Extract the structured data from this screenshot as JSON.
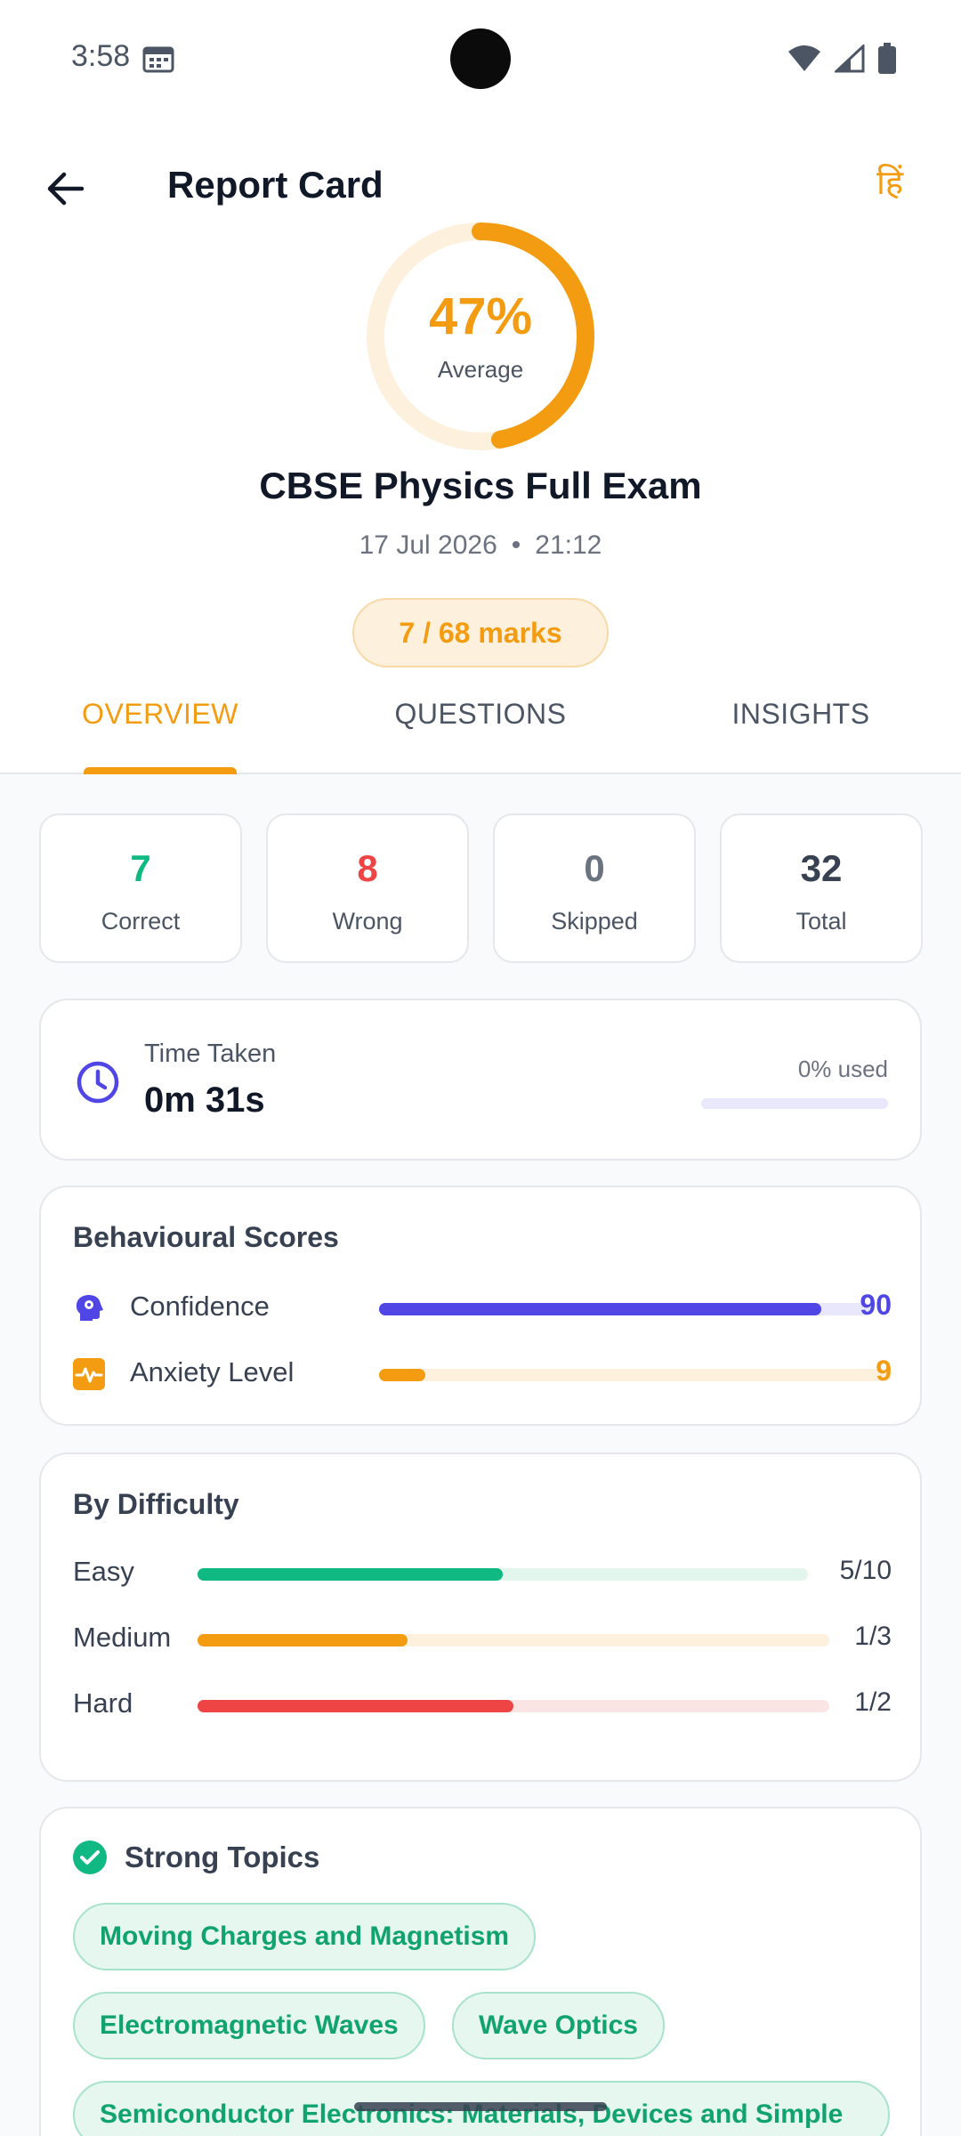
{
  "status_bar": {
    "time": "3:58"
  },
  "app_bar": {
    "title": "Report Card",
    "lang_toggle": "हिं"
  },
  "score": {
    "percent_label": "47%",
    "percent_value": 47,
    "caption": "Average",
    "accent": "#f39c12",
    "track_color": "#fdf0dc"
  },
  "exam": {
    "title": "CBSE Physics Full Exam",
    "date": "17 Jul 2026",
    "separator": "•",
    "time": "21:12",
    "marks": "7 / 68 marks"
  },
  "tabs": [
    {
      "label": "OVERVIEW",
      "active": true
    },
    {
      "label": "QUESTIONS",
      "active": false
    },
    {
      "label": "INSIGHTS",
      "active": false
    }
  ],
  "stats": [
    {
      "value": "7",
      "label": "Correct",
      "color": "#10b981"
    },
    {
      "value": "8",
      "label": "Wrong",
      "color": "#ef4444"
    },
    {
      "value": "0",
      "label": "Skipped",
      "color": "#6b7280"
    },
    {
      "value": "32",
      "label": "Total",
      "color": "#374151"
    }
  ],
  "time_taken": {
    "label": "Time Taken",
    "value": "0m 31s",
    "used_label": "0% used",
    "used_fraction": 0.0,
    "accent": "#4f46e5"
  },
  "behaviour": {
    "title": "Behavioural Scores",
    "rows": [
      {
        "label": "Confidence",
        "value": "90",
        "fraction": 0.9,
        "color": "#4f46e5",
        "track": "#e8e7fb",
        "icon": "brain-icon"
      },
      {
        "label": "Anxiety Level",
        "value": "9",
        "fraction": 0.09,
        "color": "#f39c12",
        "track": "#fdf0dc",
        "icon": "pulse-icon"
      }
    ]
  },
  "difficulty": {
    "title": "By Difficulty",
    "rows": [
      {
        "label": "Easy",
        "value": "5/10",
        "fraction": 0.5,
        "color": "#10b981",
        "track": "#e3f6ee"
      },
      {
        "label": "Medium",
        "value": "1/3",
        "fraction": 0.333,
        "color": "#f39c12",
        "track": "#fdf0dc"
      },
      {
        "label": "Hard",
        "value": "1/2",
        "fraction": 0.5,
        "color": "#ef4444",
        "track": "#fbe4e4"
      }
    ]
  },
  "strong_topics": {
    "title": "Strong Topics",
    "chips": [
      "Moving Charges and Magnetism",
      "Electromagnetic Waves",
      "Wave Optics",
      "Semiconductor Electronics: Materials, Devices and Simple"
    ]
  }
}
